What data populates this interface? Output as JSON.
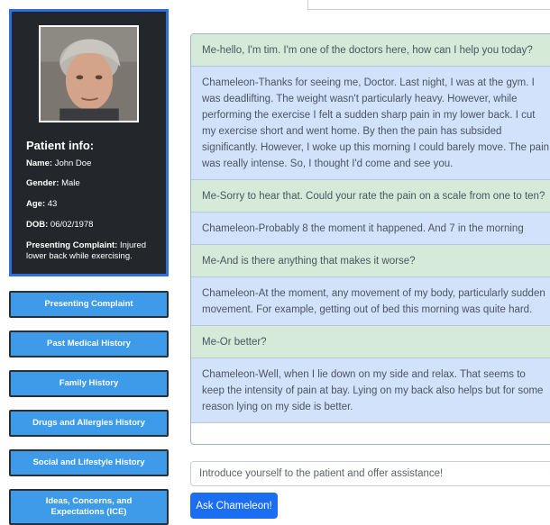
{
  "patient": {
    "title": "Patient info:",
    "name_label": "Name:",
    "name": "John Doe",
    "gender_label": "Gender:",
    "gender": "Male",
    "age_label": "Age:",
    "age": "43",
    "dob_label": "DOB:",
    "dob": "06/02/1978",
    "complaint_label": "Presenting Complaint:",
    "complaint": "Injured lower back while exercising."
  },
  "sidebar": {
    "buttons": [
      {
        "label": "Presenting Complaint"
      },
      {
        "label": "Past Medical History"
      },
      {
        "label": "Family History"
      },
      {
        "label": "Drugs and Allergies History"
      },
      {
        "label": "Social and Lifestyle History"
      },
      {
        "label": "Ideas, Concerns, and Expectations (ICE)"
      }
    ]
  },
  "chat": {
    "messages": [
      {
        "speaker": "me",
        "text": "Me-hello, I'm tim. I'm one of the doctors here, how can I help you today?"
      },
      {
        "speaker": "chameleon",
        "text": "Chameleon-Thanks for seeing me, Doctor. Last night, I was at the gym. I was deadlifting. The weight wasn't particularly heavy. However, while performing the exercise I felt a sudden sharp pain in my lower back. I cut my exercise short and went home. By then the pain has subsided significantly. However, I woke up this morning I could barely move. The pain was really intense. So, I thought I'd come and see you."
      },
      {
        "speaker": "me",
        "text": "Me-Sorry to hear that. Could your rate the pain on a scale from one to ten?"
      },
      {
        "speaker": "chameleon",
        "text": "Chameleon-Probably 8 the moment it happened. And 7 in the morning"
      },
      {
        "speaker": "me",
        "text": "Me-And is there anything that makes it worse?"
      },
      {
        "speaker": "chameleon",
        "text": "Chameleon-At the moment, any movement of my body, particularly sudden movement. For example, getting out of bed this morning was quite hard."
      },
      {
        "speaker": "me",
        "text": "Me-Or better?"
      },
      {
        "speaker": "chameleon",
        "text": "Chameleon-Well, when I lie down on my side and relax. That seems to keep the intensity of pain at bay. Lying on my back also helps but for some reason lying on my side is better."
      }
    ]
  },
  "input": {
    "placeholder": "Introduce yourself to the patient and offer assistance!",
    "value": ""
  },
  "ask_button": {
    "label": "Ask Chameleon!"
  },
  "colors": {
    "me_bg": "#d6ead9",
    "chameleon_bg": "#d2e2fb",
    "sidebar_button": "#3d9be9",
    "ask_button": "#1b6ef2",
    "card_bg": "#23272b",
    "card_border": "#2f6fdc"
  }
}
